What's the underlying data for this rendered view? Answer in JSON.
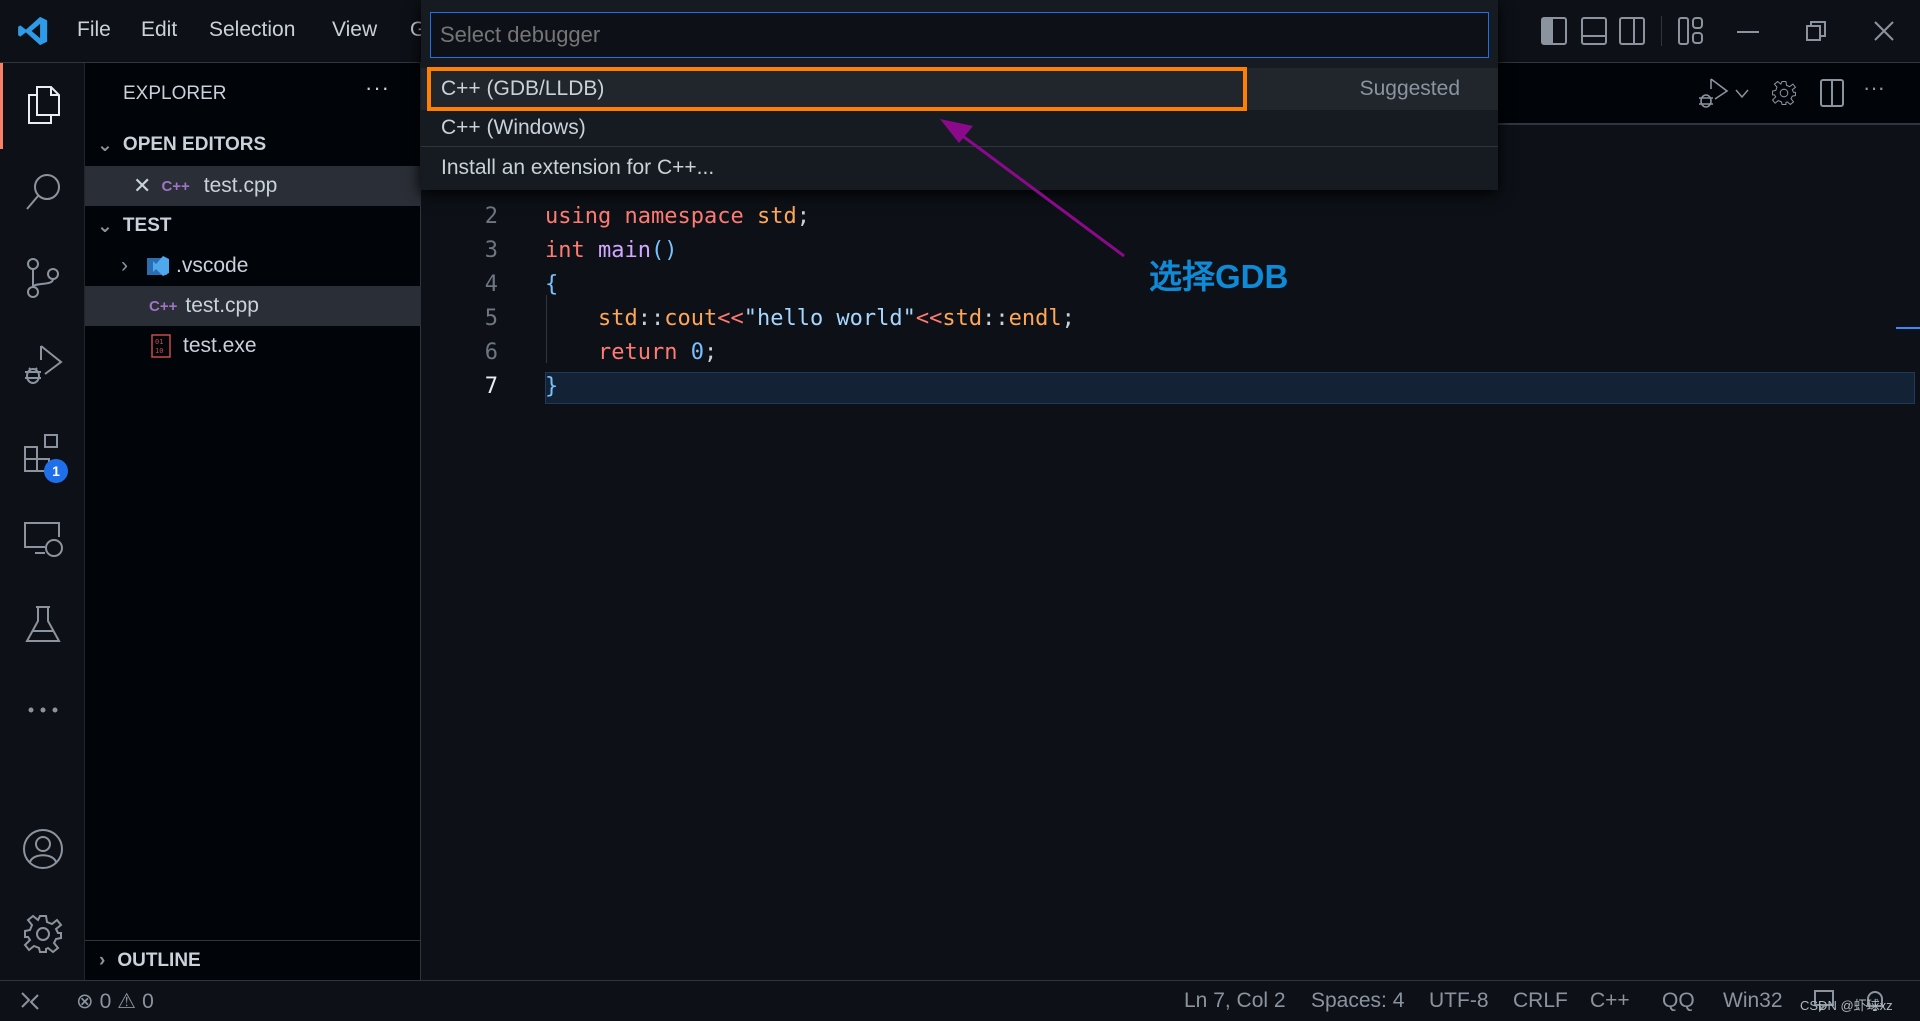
{
  "menu": [
    "File",
    "Edit",
    "Selection",
    "View",
    "G"
  ],
  "sidebar": {
    "title": "EXPLORER",
    "more": "···",
    "open_editors": "OPEN EDITORS",
    "open_file": "test.cpp",
    "folder": "TEST",
    "files": [
      ".vscode",
      "test.cpp",
      "test.exe"
    ],
    "outline": "OUTLINE",
    "cpp_badge": "C++"
  },
  "activity": {
    "extensions_badge": "1"
  },
  "quickpick": {
    "placeholder": "Select debugger",
    "items": [
      {
        "label": "C++ (GDB/LLDB)",
        "detail": "Suggested"
      },
      {
        "label": "C++ (Windows)"
      },
      {
        "label": "Install an extension for C++..."
      }
    ]
  },
  "editor": {
    "lines": [
      {
        "n": "2"
      },
      {
        "n": "3"
      },
      {
        "n": "4"
      },
      {
        "n": "5"
      },
      {
        "n": "6"
      },
      {
        "n": "7"
      }
    ],
    "tokens": {
      "using": "using",
      "namespace": "namespace",
      "std": "std",
      ";": ";",
      "int": "int",
      "main": "main",
      "parens": "()",
      "lb": "{",
      "rb": "}",
      "std2": "std",
      "sep": "::",
      "cout": "cout",
      "op1": "<<",
      "str": "\"hello world\"",
      "op2": "<<",
      "std3": "std",
      "sep2": "::",
      "endl": "endl",
      "semi2": ";",
      "return": "return",
      "zero": "0",
      "semi3": ";"
    }
  },
  "annotation": {
    "text": "选择GDB",
    "color": "#0e8ad6",
    "arrow_color": "#8b0a8b",
    "highlight_color": "#ff8000"
  },
  "status": {
    "errors": "0",
    "warnings": "0",
    "position": "Ln 7, Col 2",
    "spaces": "Spaces: 4",
    "encoding": "UTF-8",
    "eol": "CRLF",
    "language": "C++",
    "qq": "QQ",
    "platform": "Win32"
  },
  "watermark": "CSDN @虾球xz"
}
